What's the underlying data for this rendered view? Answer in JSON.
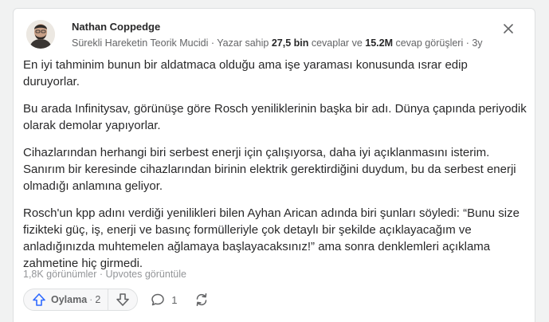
{
  "author": {
    "name": "Nathan Coppedge",
    "credential": "Sürekli Hareketin Teorik Mucidi",
    "sep1": " · ",
    "stats_prefix": "Yazar sahip ",
    "answers_count": "27,5 bin",
    "answers_suffix": " cevaplar ve ",
    "views_count": "15.2M",
    "views_suffix": " cevap görüşleri",
    "sep2": " · ",
    "age": "3y"
  },
  "paragraphs": [
    "En iyi tahminim bunun bir aldatmaca olduğu ama işe yaraması konusunda ısrar edip duruyorlar.",
    "Bu arada Infinitysav, görünüşe göre Rosch yeniliklerinin başka bir adı. Dünya çapında periyodik olarak demolar yapıyorlar.",
    "Cihazlarından herhangi biri serbest enerji için çalışıyorsa, daha iyi açıklanmasını isterim. Sanırım bir keresinde cihazlarından birinin elektrik gerektirdiğini duydum, bu da serbest enerji olmadığı anlamına geliyor.",
    "Rosch'un kpp adını verdiği yenilikleri bilen Ayhan Arican adında biri şunları söyledi: “Bunu size fizikteki güç, iş, enerji ve basınç formülleriyle çok detaylı bir şekilde açıklayacağım ve anladığınızda muhtemelen ağlamaya başlayacaksınız!” ama sonra denklemleri açıklama zahmetine hiç girmedi."
  ],
  "footer": {
    "views": "1,8K görünümler",
    "sep": " · ",
    "upvotes_link": "Upvotes görüntüle"
  },
  "actions": {
    "upvote_label": "Oylama",
    "upvote_dot": "·",
    "upvote_count": "2",
    "comment_count": "1"
  },
  "icons": {
    "upvote": "arrow-up-outline-icon",
    "downvote": "arrow-down-outline-icon",
    "comment": "speech-bubble-icon",
    "share": "refresh-arrows-icon",
    "close": "close-icon"
  },
  "colors": {
    "upvote_blue": "#2e69ff",
    "text": "#282829",
    "muted": "#636466",
    "light": "#939598",
    "border": "#dee0e1",
    "page_bg": "#f1f2f2"
  }
}
